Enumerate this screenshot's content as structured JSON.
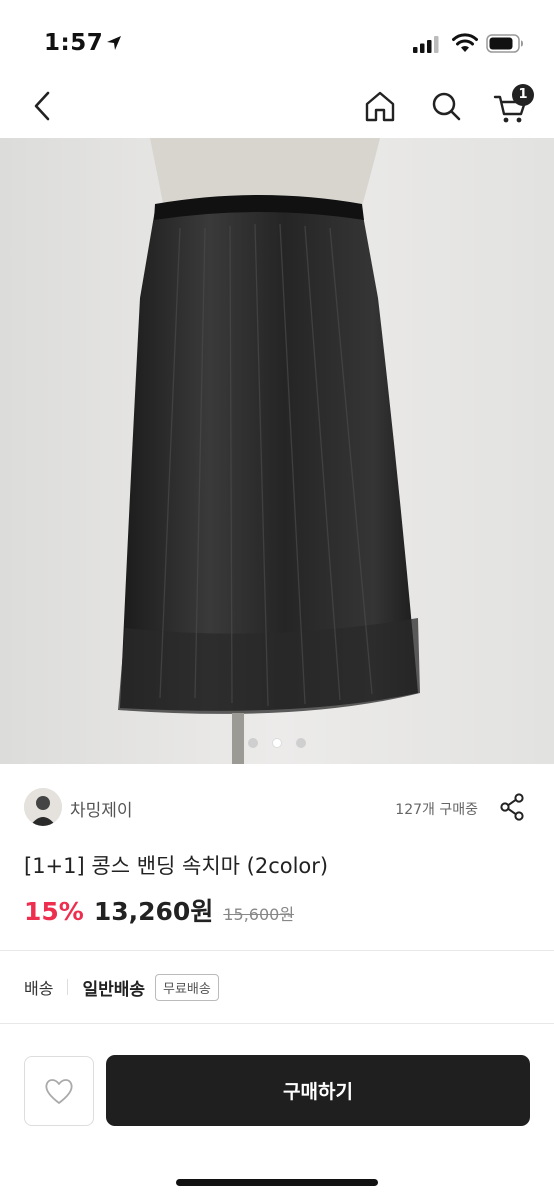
{
  "status_bar": {
    "time": "1:57"
  },
  "nav": {
    "cart_count": "1"
  },
  "product": {
    "image_alt": "black pleated half slip skirt on mannequin",
    "image_count": 3,
    "active_image": 1
  },
  "seller": {
    "name": "차밍제이",
    "purchase_count": "127개 구매중"
  },
  "title": "[1+1] 콩스 밴딩 속치마 (2color)",
  "pricing": {
    "discount": "15%",
    "price": "13,260원",
    "original_price": "15,600원"
  },
  "shipping": {
    "label": "배송",
    "type": "일반배송",
    "badge": "무료배송"
  },
  "actions": {
    "buy_label": "구매하기"
  },
  "colors": {
    "discount": "#ee2e4e",
    "buy_button": "#1f1f1f"
  }
}
